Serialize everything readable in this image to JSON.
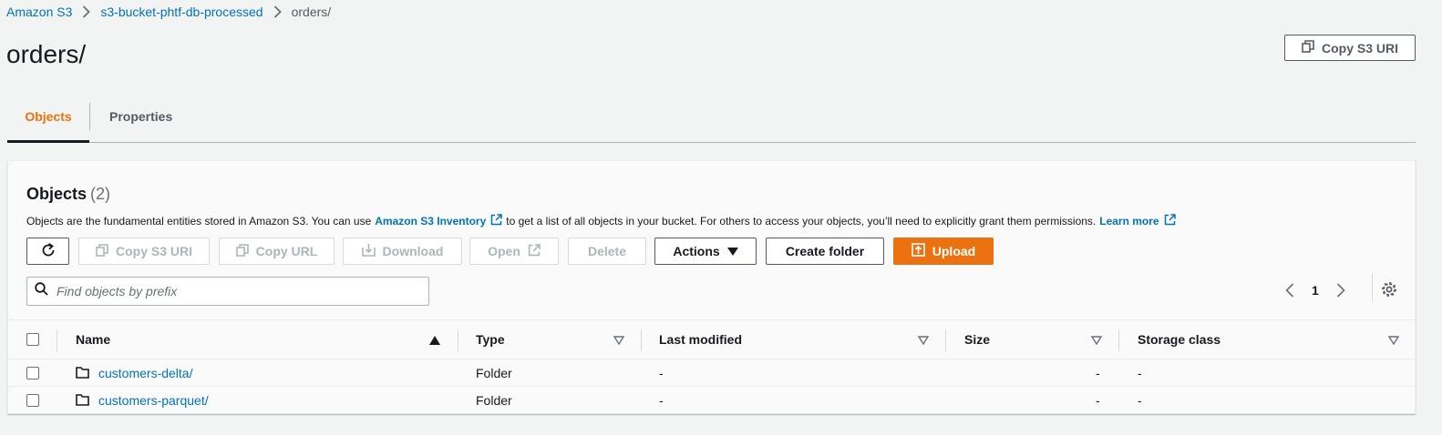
{
  "breadcrumb": {
    "items": [
      "Amazon S3",
      "s3-bucket-phtf-db-processed",
      "orders/"
    ]
  },
  "page": {
    "title": "orders/",
    "copy_uri_label": "Copy S3 URI"
  },
  "tabs": [
    {
      "label": "Objects",
      "active": true
    },
    {
      "label": "Properties",
      "active": false
    }
  ],
  "objects": {
    "heading": "Objects",
    "count": "(2)",
    "description_pre": "Objects are the fundamental entities stored in Amazon S3. You can use",
    "inventory_link": "Amazon S3 Inventory",
    "description_mid": "to get a list of all objects in your bucket. For others to access your objects, you’ll need to explicitly grant them permissions.",
    "learn_more": "Learn more",
    "toolbar": {
      "copy_s3_uri": "Copy S3 URI",
      "copy_url": "Copy URL",
      "download": "Download",
      "open": "Open",
      "delete": "Delete",
      "actions": "Actions",
      "create_folder": "Create folder",
      "upload": "Upload"
    },
    "search": {
      "placeholder": "Find objects by prefix",
      "value": ""
    },
    "pagination": {
      "current_page": "1"
    },
    "columns": [
      "Name",
      "Type",
      "Last modified",
      "Size",
      "Storage class"
    ],
    "rows": [
      {
        "name": "customers-delta/",
        "type": "Folder",
        "last_modified": "-",
        "size": "-",
        "storage_class": "-"
      },
      {
        "name": "customers-parquet/",
        "type": "Folder",
        "last_modified": "-",
        "size": "-",
        "storage_class": "-"
      }
    ]
  },
  "colors": {
    "accent_orange": "#ec7211",
    "link_blue": "#0073bb",
    "text_dark": "#16191f",
    "text_gray": "#545b64",
    "disabled": "#aab7b8",
    "page_bg": "#f2f3f3"
  },
  "icons": [
    "chevron-right-icon",
    "copy-icon",
    "refresh-icon",
    "external-link-icon",
    "download-icon",
    "caret-down-icon",
    "upload-icon",
    "search-icon",
    "chevron-left-icon",
    "gear-icon",
    "sort-ascending-icon",
    "sort-icon",
    "folder-icon"
  ]
}
